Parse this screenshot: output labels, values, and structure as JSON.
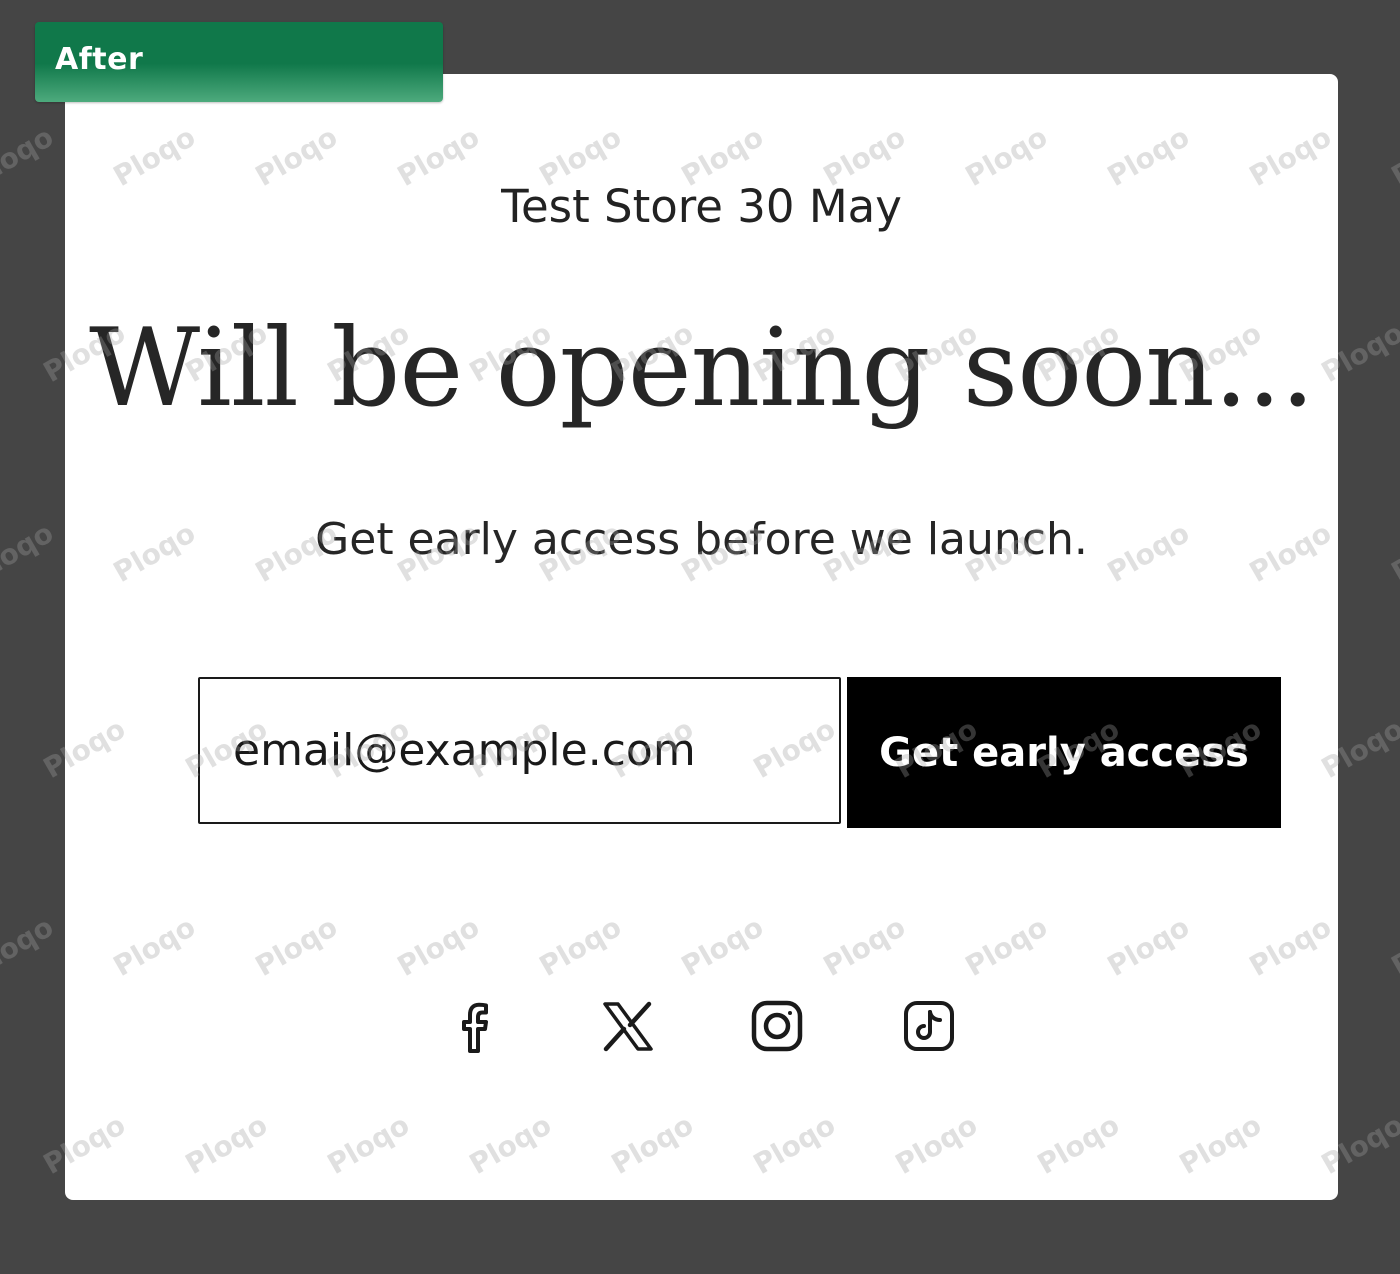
{
  "badge": {
    "label": "After",
    "color": "#10784a"
  },
  "store": {
    "name": "Test Store 30 May"
  },
  "hero": {
    "headline": "Will be opening soon...",
    "subheadline": "Get early access before we launch."
  },
  "signup": {
    "email_placeholder": "email@example.com",
    "button_label": "Get early access"
  },
  "social_links": [
    {
      "icon": "facebook-icon"
    },
    {
      "icon": "x-twitter-icon"
    },
    {
      "icon": "instagram-icon"
    },
    {
      "icon": "tiktok-icon"
    }
  ],
  "watermark": {
    "text": "Ploqo"
  },
  "colors": {
    "background": "#454545",
    "card": "#ffffff",
    "text": "#262626",
    "button_bg": "#000000",
    "button_text": "#ffffff"
  }
}
